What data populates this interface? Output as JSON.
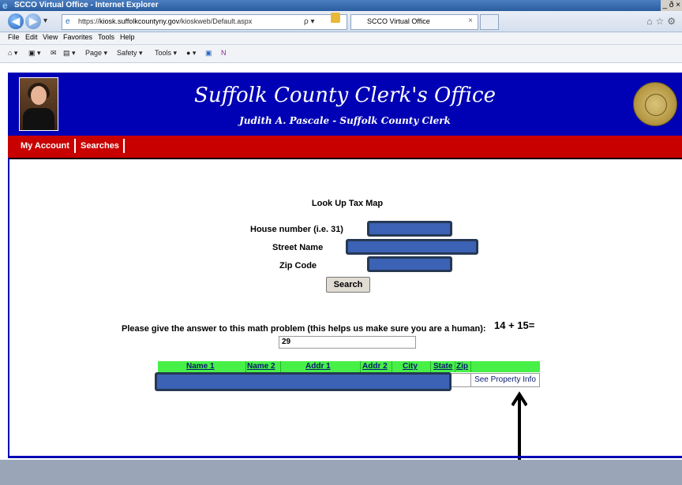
{
  "browser": {
    "window_title": "SCCO Virtual Office - Internet Explorer",
    "window_buttons": "_ ð ×",
    "address_prefix": "https://",
    "address_domain": "kiosk.suffolkcountyny.gov",
    "address_path": "/kioskweb/Default.aspx",
    "address_tools": "ρ ▾",
    "tab_title": "SCCO Virtual Office",
    "tab_close": "×",
    "menu": [
      "File",
      "Edit",
      "View",
      "Favorites",
      "Tools",
      "Help"
    ],
    "commands": [
      "Page ▾",
      "Safety ▾",
      "Tools ▾"
    ]
  },
  "site": {
    "title": "Suffolk County Clerk's Office",
    "subtitle": "Judith A. Pascale - Suffolk County Clerk",
    "nav": [
      "My Account",
      "Searches"
    ]
  },
  "lookup": {
    "title": "Look Up Tax Map",
    "house_label": "House number (i.e. 31)",
    "street_label": "Street Name",
    "zip_label": "Zip Code",
    "search_button": "Search"
  },
  "math": {
    "question": "Please give the answer to this math problem (this helps us make sure you are a human):",
    "equation": "14 + 15=",
    "answer": "29"
  },
  "results": {
    "columns": [
      "Name 1",
      "Name 2",
      "Addr 1",
      "Addr 2",
      "City",
      "State",
      "Zip"
    ],
    "action_link": "See Property Info"
  },
  "colors": {
    "header_blue": "#0000b4",
    "nav_red": "#c80000",
    "table_header_green": "#47f047",
    "redaction_blue": "#3b62b5"
  }
}
